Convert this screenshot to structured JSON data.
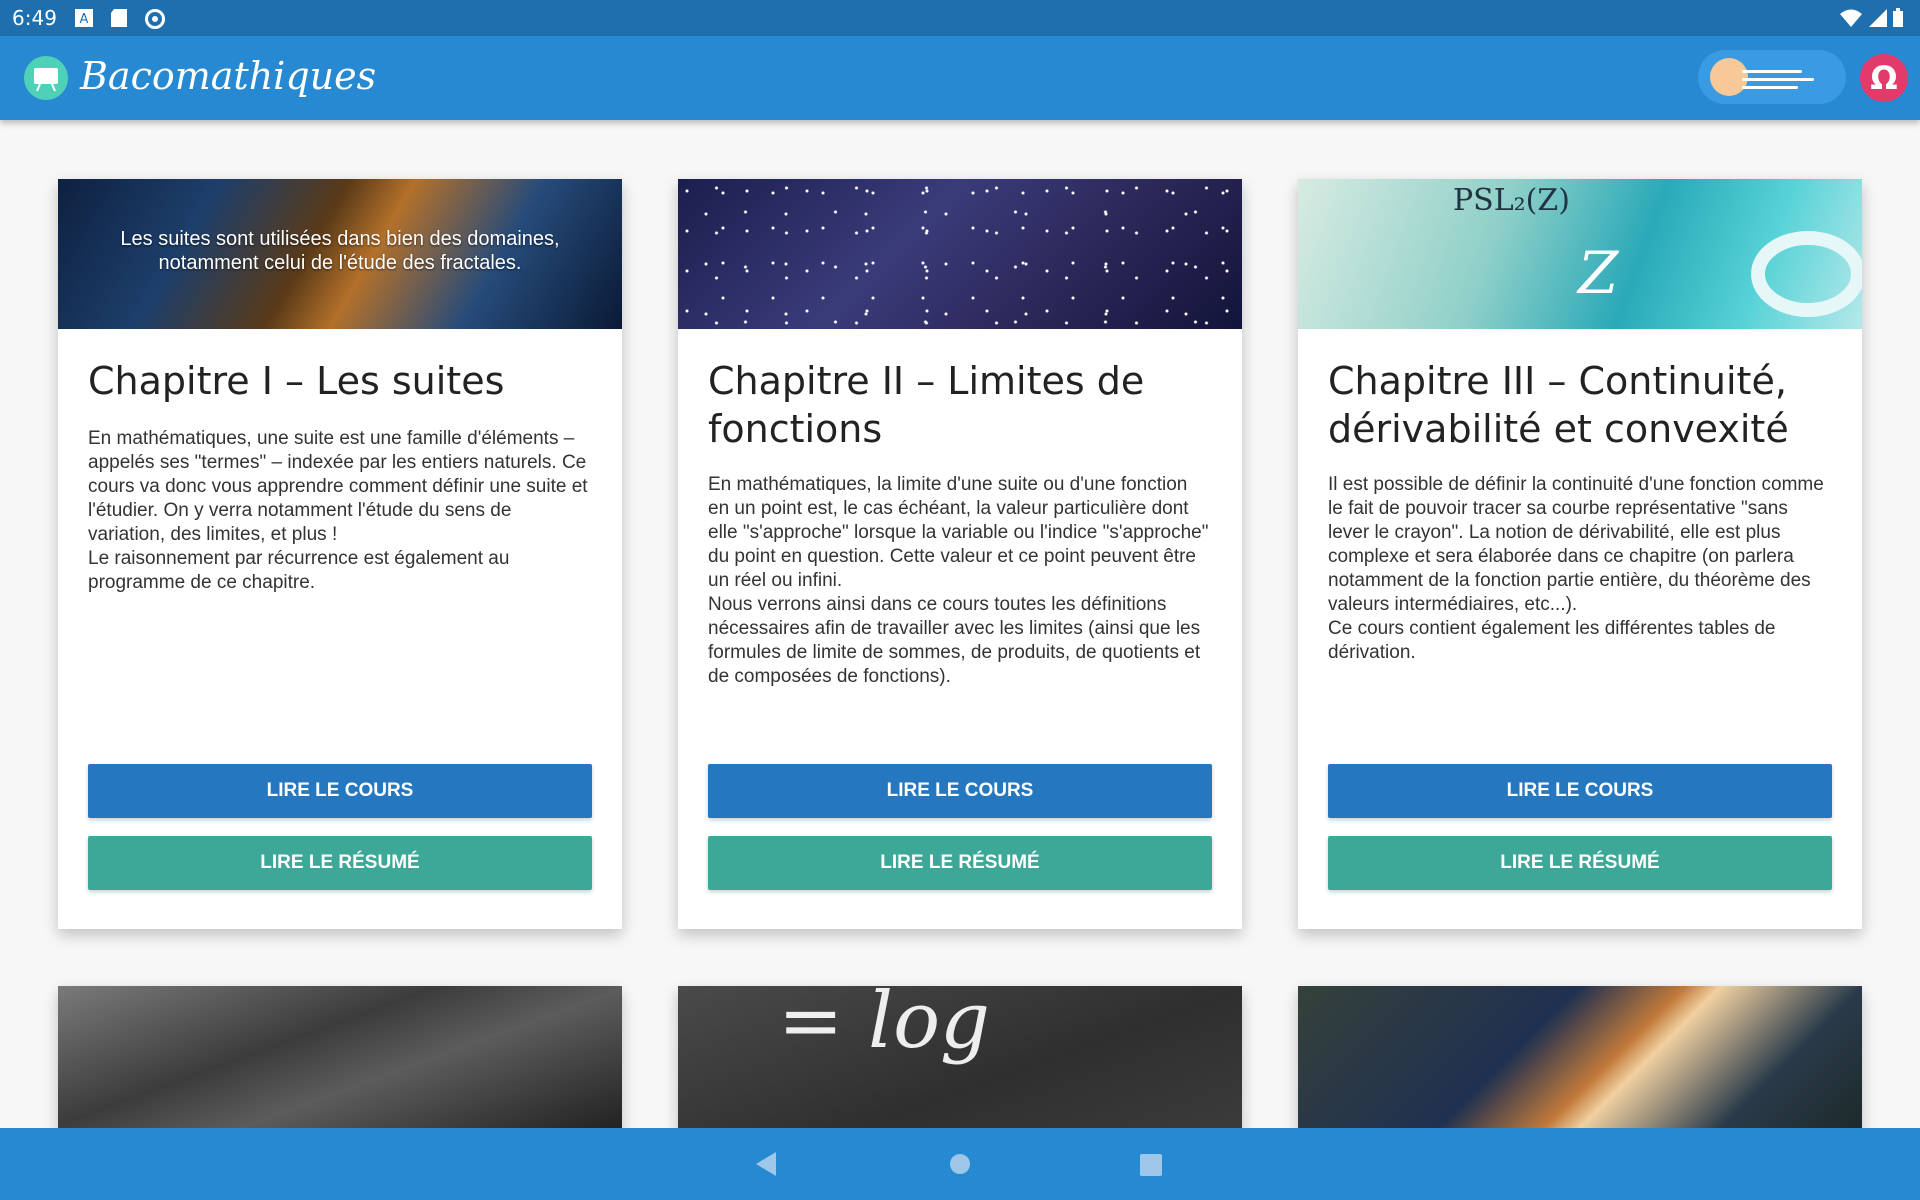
{
  "status_bar": {
    "time": "6:49",
    "icons": [
      "a-icon",
      "sd-card-icon",
      "sync-icon"
    ],
    "right_icons": [
      "wifi-icon",
      "signal-icon",
      "battery-icon"
    ]
  },
  "app_bar": {
    "title": "Bacomathiques",
    "omega_label": "Ω",
    "colors": {
      "primary": "#2789d1",
      "accent": "#e23a6a"
    }
  },
  "cards": [
    {
      "image": "fractal-image",
      "caption": "Les suites sont utilisées dans bien des domaines, notamment celui de l'étude des fractales.",
      "title": "Chapitre I – Les suites",
      "description": "En mathématiques, une suite est une famille d'éléments – appelés ses \"termes\" – indexée par les entiers naturels. Ce cours va donc vous apprendre comment définir une suite et l'étudier. On y verra notamment l'étude du sens de variation, des limites, et plus !\nLe raisonnement par récurrence est également au programme de ce chapitre.",
      "btn_cours": "LIRE LE COURS",
      "btn_resume": "LIRE LE RÉSUMÉ"
    },
    {
      "image": "starfield-image",
      "caption": "",
      "title": "Chapitre II – Limites de fonctions",
      "description": "En mathématiques, la limite d'une suite ou d'une fonction en un point est, le cas échéant, la valeur particulière dont elle \"s'approche\" lorsque la variable ou l'indice \"s'approche\" du point en question. Cette valeur et ce point peuvent être un réel ou infini.\nNous verrons ainsi dans ce cours toutes les définitions nécessaires afin de travailler avec les limites (ainsi que les formules de limite de sommes, de produits, de quotients et de composées de fonctions).",
      "btn_cours": "LIRE LE COURS",
      "btn_resume": "LIRE LE RÉSUMÉ"
    },
    {
      "image": "math-diagram-image",
      "caption": "",
      "image_text": {
        "psl": "PSL₂(Z)",
        "z": "Z"
      },
      "title": "Chapitre III – Continuité, dérivabilité et convexité",
      "description": "Il est possible de définir la continuité d'une fonction comme le fait de pouvoir tracer sa courbe représentative \"sans lever le crayon\". La notion de dérivabilité, elle est plus complexe et sera élaborée dans ce chapitre (on parlera notamment de la fonction partie entière, du théorème des valeurs intermédiaires, etc...).\nCe cours contient également les différentes tables de dérivation.",
      "btn_cours": "LIRE LE COURS",
      "btn_resume": "LIRE LE RÉSUMÉ"
    }
  ],
  "partial_cards": [
    {
      "image": "keyboard-image"
    },
    {
      "image": "chalkboard-log-image",
      "image_text": "= log"
    },
    {
      "image": "highway-lights-image"
    }
  ],
  "nav_bar": {
    "icons": [
      "back-icon",
      "home-icon",
      "recents-icon"
    ]
  }
}
